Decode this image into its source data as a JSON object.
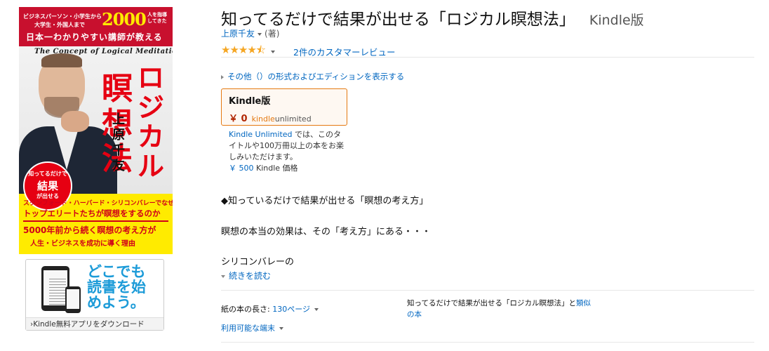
{
  "cover": {
    "line1": "ビジネスパーソン・小学生から",
    "line2": "大学生・外国人まで",
    "number": "2000",
    "line3": "人を指導してきた",
    "tagline": "日本一わかりやすい講師が教える",
    "concept": "The Concept of Logical Meditation",
    "title_part1": "ロジカル",
    "title_part2": "瞑想法",
    "author": "上原千友",
    "badge_top": "知ってるだけで",
    "badge_mid": "結果",
    "badge_bottom": "が出せる",
    "yellow1": "スタンフォード・ハーバード・シリコンバレーでなぜ、",
    "yellow2": "トップエリートたちが瞑想をするのか",
    "yellow3": "5000年前から続く瞑想の考え方が",
    "yellow4": "人生・ビジネスを成功に導く理由"
  },
  "app_banner": {
    "message": "どこでも\n読書を始\nめよう。",
    "footer": "›Kindle無料アプリをダウンロード"
  },
  "product": {
    "title": "知ってるだけで結果が出せる「ロジカル瞑想法」",
    "format": "Kindle版",
    "author": "上原千友",
    "author_role": "(著)",
    "stars": "★★★★⯪",
    "review_link": "2件のカスタマーレビュー",
    "other_formats": "その他（）の形式およびエディションを表示する",
    "box_label": "Kindle版",
    "box_price": "￥ 0",
    "ku_kindle": "kindle",
    "ku_unlimited": "unlimited",
    "ku_link": "Kindle Unlimited",
    "ku_text": " では、このタイトルや100万冊以上の本をお楽しみいただけます。",
    "kindle_price_value": "￥ 500",
    "kindle_price_label": " Kindle 価格"
  },
  "description": {
    "line1": "◆知っているだけで結果が出せる「瞑想の考え方」",
    "line2": "瞑想の本当の効果は、その「考え方」にある・・・",
    "line3": "シリコンバレーの",
    "read_more": "続きを読む"
  },
  "details": {
    "pages_label": "紙の本の長さ: ",
    "pages_value": "130ページ",
    "devices": "利用可能な端末",
    "similar_text": "知ってるだけで結果が出せる「ロジカル瞑想法」と",
    "similar_link": "類似の本"
  },
  "colors": {
    "link": "#0066c0",
    "price": "#b12704",
    "accent_orange": "#e47911",
    "star": "#f5a623",
    "cover_red": "#e60012",
    "cover_yellow": "#ffeb00"
  }
}
